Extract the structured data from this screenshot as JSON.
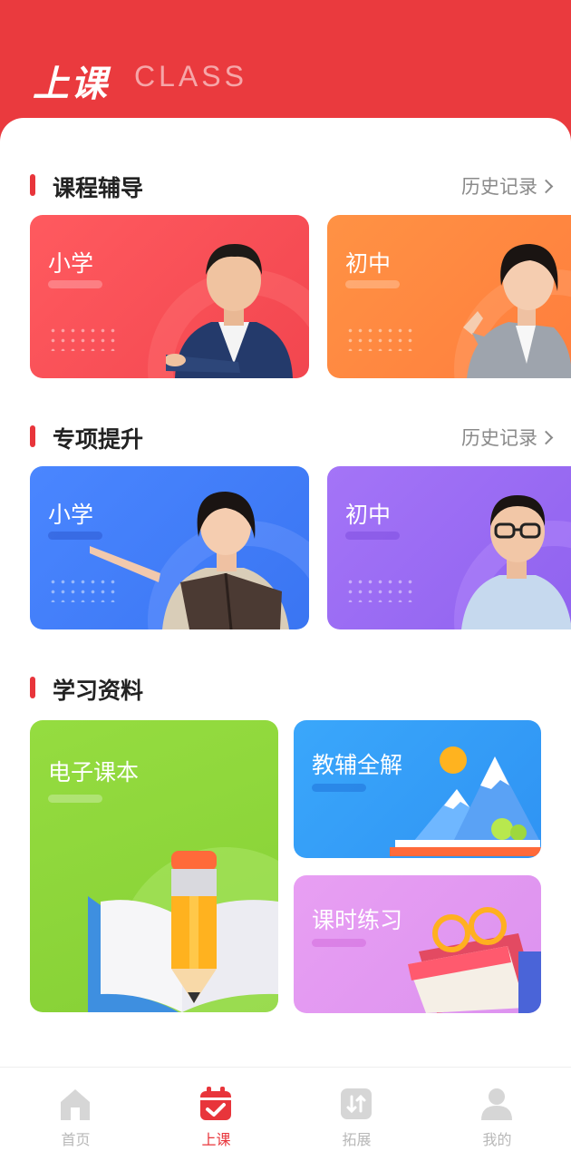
{
  "header": {
    "title": "上课",
    "subtitle": "CLASS"
  },
  "sections": [
    {
      "title": "课程辅导",
      "history": "历史记录",
      "cards": [
        {
          "label": "小学"
        },
        {
          "label": "初中"
        }
      ]
    },
    {
      "title": "专项提升",
      "history": "历史记录",
      "cards": [
        {
          "label": "小学"
        },
        {
          "label": "初中"
        }
      ]
    },
    {
      "title": "学习资料",
      "cards": [
        {
          "label": "电子课本"
        },
        {
          "label": "教辅全解"
        },
        {
          "label": "课时练习"
        }
      ]
    }
  ],
  "tabs": [
    {
      "label": "首页",
      "icon": "home-icon"
    },
    {
      "label": "上课",
      "icon": "class-calendar-icon"
    },
    {
      "label": "拓展",
      "icon": "expand-icon"
    },
    {
      "label": "我的",
      "icon": "profile-icon"
    }
  ],
  "colors": {
    "brand_red": "#e83a3e",
    "card_red": "#f7525a",
    "card_orange": "#ff8a45",
    "card_blue": "#3f7cf5",
    "card_purple": "#9a6cf3",
    "card_green": "#8dd83e",
    "card_sky": "#3ea2f8",
    "card_pink": "#e29af0"
  }
}
